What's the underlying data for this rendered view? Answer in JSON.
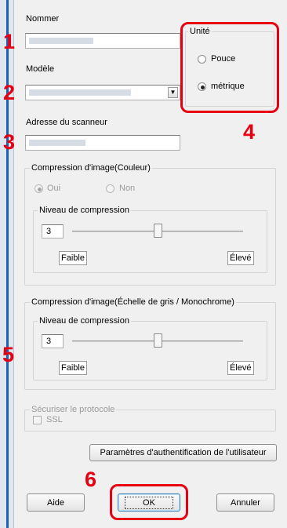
{
  "labels": {
    "name": "Nommer",
    "model": "Modèle",
    "scanner_address": "Adresse du scanneur"
  },
  "unit": {
    "title": "Unité",
    "options": [
      "Pouce",
      "métrique"
    ],
    "selected": "métrique"
  },
  "color_compression": {
    "title": "Compression d'image(Couleur)",
    "options": [
      "Oui",
      "Non"
    ],
    "selected": "Oui",
    "level_title": "Niveau de compression",
    "level_value": "3",
    "level_fraction": 0.5,
    "low_label": "Faible",
    "high_label": "Élevé"
  },
  "gray_compression": {
    "title": "Compression d'image(Échelle de gris / Monochrome)",
    "level_title": "Niveau de compression",
    "level_value": "3",
    "level_fraction": 0.5,
    "low_label": "Faible",
    "high_label": "Élevé"
  },
  "secure_protocol": {
    "title": "Sécuriser le protocole",
    "ssl_label": "SSL",
    "ssl_checked": false
  },
  "buttons": {
    "user_auth": "Paramètres d'authentification de l'utilisateur",
    "help": "Aide",
    "ok": "OK",
    "cancel": "Annuler"
  },
  "callouts": [
    "1",
    "2",
    "3",
    "4",
    "5",
    "6"
  ],
  "colors": {
    "callout": "#e60012",
    "dialog_bg": "#f0f0f0"
  }
}
